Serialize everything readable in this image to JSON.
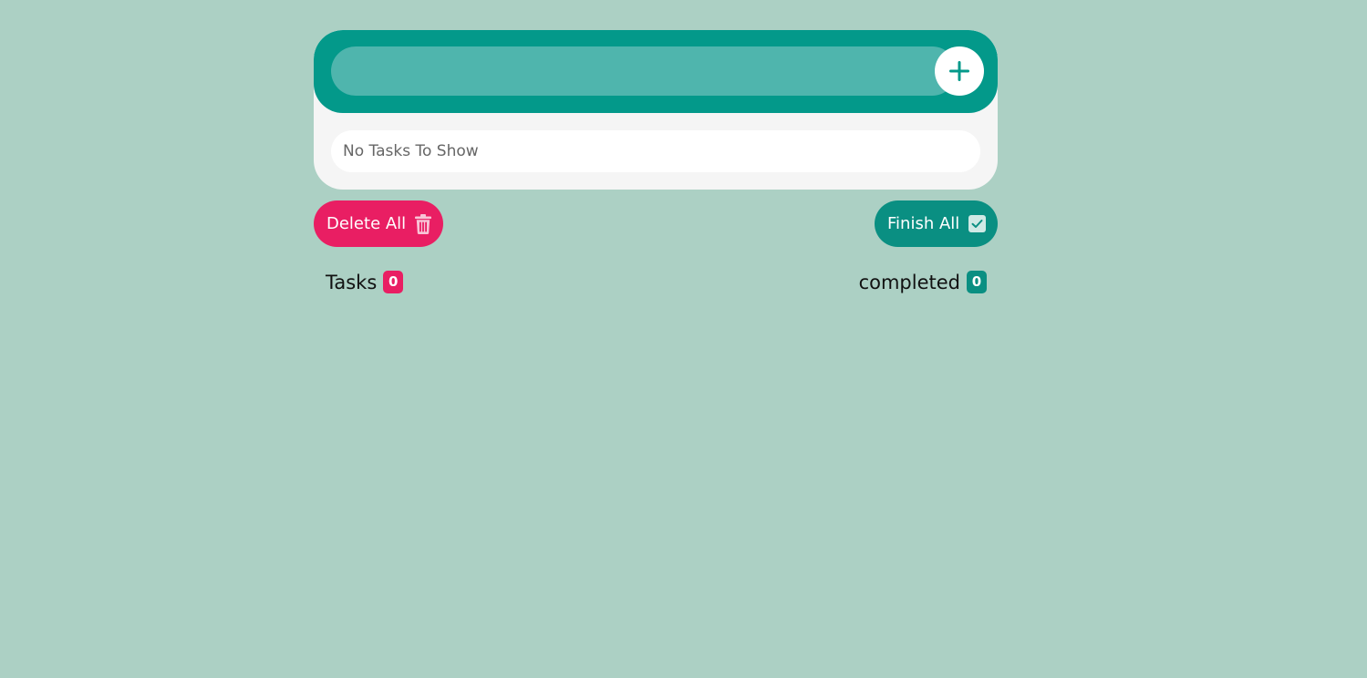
{
  "input": {
    "value": "",
    "placeholder": ""
  },
  "add_button": {
    "icon": "plus-icon"
  },
  "tasks": {
    "empty_message": "No Tasks To Show",
    "items": []
  },
  "actions": {
    "delete_all_label": "Delete All",
    "delete_all_icon": "trash-icon",
    "finish_all_label": "Finish All",
    "finish_all_icon": "checkbox-checked-icon"
  },
  "stats": {
    "tasks_label": "Tasks",
    "tasks_count": "0",
    "completed_label": "completed",
    "completed_count": "0"
  },
  "colors": {
    "background": "#acd0c4",
    "primary_teal": "#03998a",
    "input_fill": "#4fb5ad",
    "delete_pink": "#e91e63",
    "finish_teal": "#0a8f82",
    "card": "#f5f5f5"
  }
}
